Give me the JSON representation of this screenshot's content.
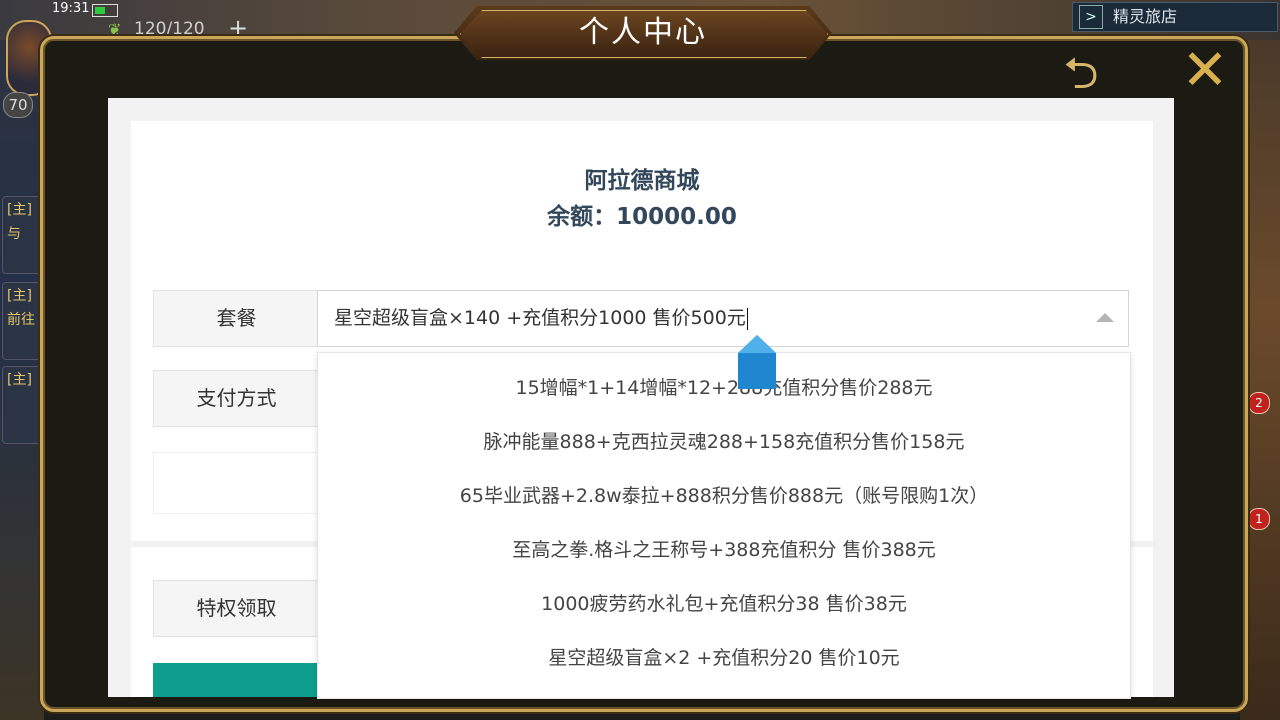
{
  "status": {
    "time": "19:31"
  },
  "player": {
    "level": "70",
    "stamina": "120/120"
  },
  "topbar": {
    "right_button": "精灵旅店"
  },
  "side_badges": [
    "2",
    "1"
  ],
  "side_tabs": [
    "[主]",
    "与",
    "[主]",
    "前往",
    "[主]"
  ],
  "modal": {
    "title": "个人中心"
  },
  "shop": {
    "name": "阿拉德商城",
    "balance": "余额：10000.00"
  },
  "form": {
    "package_label": "套餐",
    "package_value": "星空超级盲盒×140 +充值积分1000 售价500元",
    "payment_label": "支付方式",
    "privilege_label": "特权领取"
  },
  "dropdown": {
    "options": [
      "15增幅*1+14增幅*12+288充值积分售价288元",
      "脉冲能量888+克西拉灵魂288+158充值积分售价158元",
      "65毕业武器+2.8w泰拉+888积分售价888元（账号限购1次）",
      "至高之拳.格斗之王称号+388充值积分 售价388元",
      "1000疲劳药水礼包+充值积分38 售价38元",
      "星空超级盲盒×2 +充值积分20 售价10元"
    ]
  },
  "colors": {
    "accent_teal": "#0e9e8e",
    "frame_gold": "#c9a65a",
    "heading": "#33475b"
  }
}
